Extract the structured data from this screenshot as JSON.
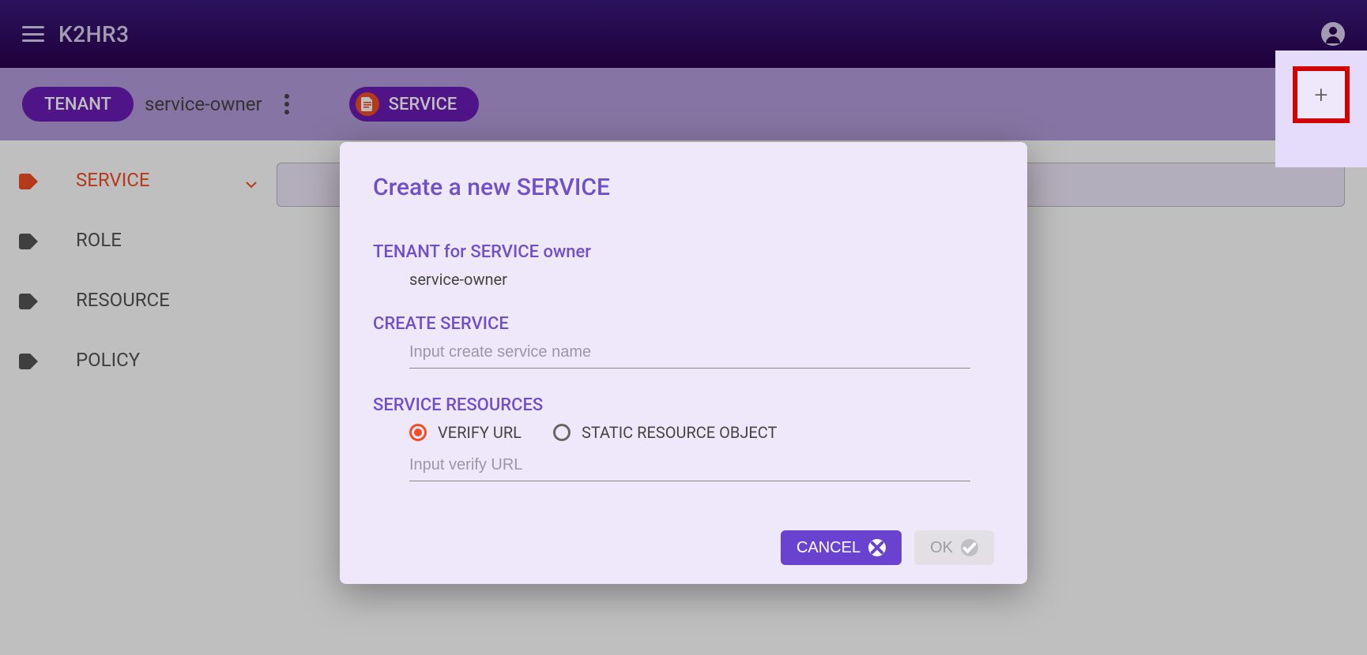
{
  "header": {
    "app_title": "K2HR3"
  },
  "toolbar": {
    "tenant_label": "TENANT",
    "tenant_name": "service-owner",
    "service_label": "SERVICE"
  },
  "sidebar": {
    "items": [
      {
        "label": "SERVICE",
        "active": true
      },
      {
        "label": "ROLE",
        "active": false
      },
      {
        "label": "RESOURCE",
        "active": false
      },
      {
        "label": "POLICY",
        "active": false
      }
    ]
  },
  "dialog": {
    "title": "Create a new SERVICE",
    "tenant_section_label": "TENANT for SERVICE owner",
    "tenant_value": "service-owner",
    "create_section_label": "CREATE SERVICE",
    "create_placeholder": "Input create service name",
    "resources_section_label": "SERVICE RESOURCES",
    "radio_verify_label": "VERIFY URL",
    "radio_static_label": "STATIC RESOURCE OBJECT",
    "verify_placeholder": "Input verify URL",
    "cancel_label": "CANCEL",
    "ok_label": "OK"
  },
  "plus": {
    "glyph": "+"
  }
}
